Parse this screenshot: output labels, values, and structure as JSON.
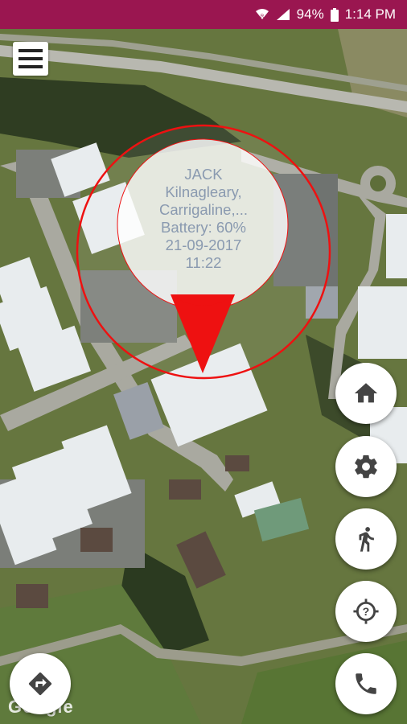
{
  "status_bar": {
    "battery": "94%",
    "time": "1:14 PM",
    "background": "#9a1650"
  },
  "popup": {
    "name": "JACK",
    "address_line1": "Kilnagleary,",
    "address_line2": "Carrigaline,...",
    "battery": "Battery: 60%",
    "date": "21-09-2017",
    "time": "11:22"
  },
  "map": {
    "attribution": "Google"
  },
  "buttons": {
    "menu": "menu-icon",
    "home": "home-icon",
    "settings": "gear-icon",
    "walk": "walk-icon",
    "locate": "location-help-icon",
    "call": "phone-icon",
    "directions": "directions-icon"
  },
  "colors": {
    "marker": "#ee1111",
    "popup_text": "#8a9ab0"
  }
}
